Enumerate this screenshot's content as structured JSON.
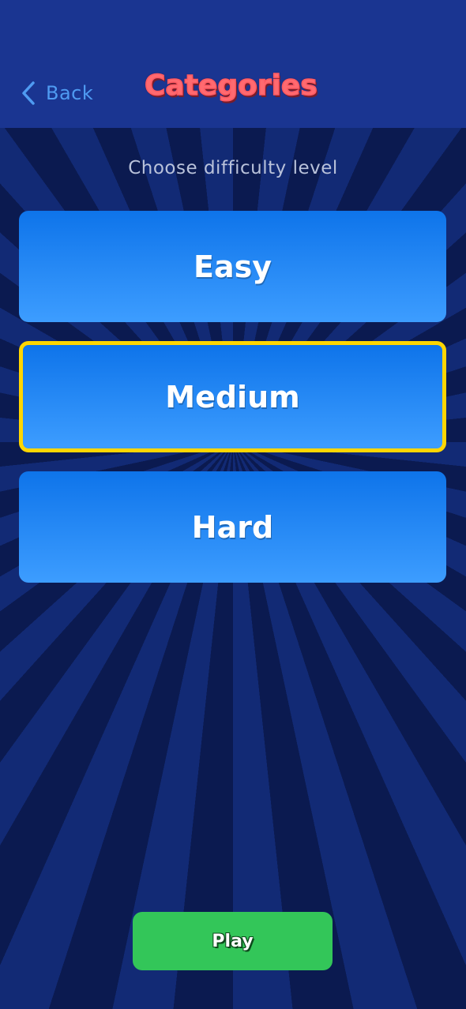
{
  "header": {
    "back_label": "Back",
    "back_icon": "chevron-left-icon",
    "title": "Categories"
  },
  "main": {
    "subtitle": "Choose difficulty level",
    "options": [
      {
        "label": "Easy",
        "selected": false
      },
      {
        "label": "Medium",
        "selected": true
      },
      {
        "label": "Hard",
        "selected": false
      }
    ],
    "play_label": "Play"
  },
  "colors": {
    "header_bg": "#1a3591",
    "background_ray_dark": "#0b1a50",
    "background_ray_light": "#122a75",
    "back_accent": "#4f9bf2",
    "title": "#ff6a70",
    "option_gradient_top": "#0e74ea",
    "option_gradient_bottom": "#3d9dff",
    "selected_border": "#ffd600",
    "play_button": "#33c659"
  }
}
